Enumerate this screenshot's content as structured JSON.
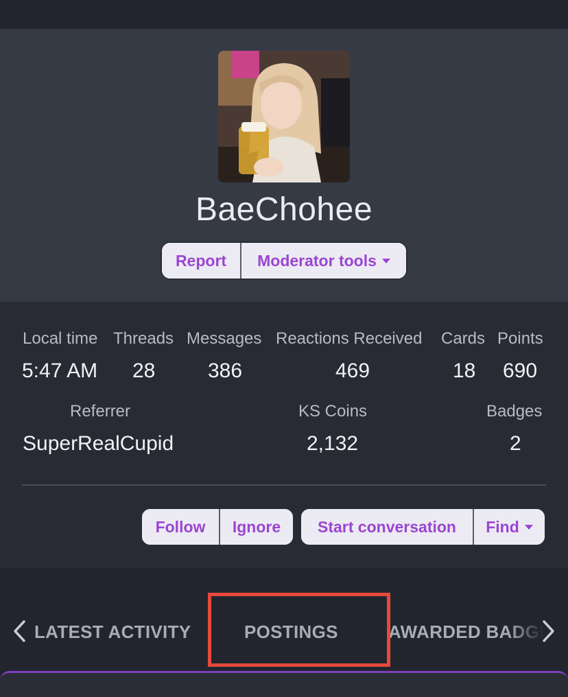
{
  "profile": {
    "username": "BaeChohee",
    "avatar_icon": "profile-photo",
    "report_label": "Report",
    "moderator_label": "Moderator tools"
  },
  "stats": {
    "row1": [
      {
        "label": "Local time",
        "value": "5:47 AM"
      },
      {
        "label": "Threads",
        "value": "28"
      },
      {
        "label": "Messages",
        "value": "386"
      },
      {
        "label": "Reactions Received",
        "value": "469"
      },
      {
        "label": "Cards",
        "value": "18"
      },
      {
        "label": "Points",
        "value": "690"
      }
    ],
    "row2": [
      {
        "label": "Referrer",
        "value": "SuperRealCupid"
      },
      {
        "label": "KS Coins",
        "value": "2,132"
      },
      {
        "label": "Badges",
        "value": "2"
      }
    ]
  },
  "actions": {
    "follow": "Follow",
    "ignore": "Ignore",
    "start_conversation": "Start conversation",
    "find": "Find"
  },
  "tabs": {
    "items": [
      "LATEST ACTIVITY",
      "POSTINGS",
      "AWARDED BADGES"
    ],
    "selected": "POSTINGS"
  },
  "colors": {
    "accent": "#9b45d2",
    "highlight": "#e8493c",
    "header_bg": "#353a45",
    "stats_bg": "#282b33"
  }
}
